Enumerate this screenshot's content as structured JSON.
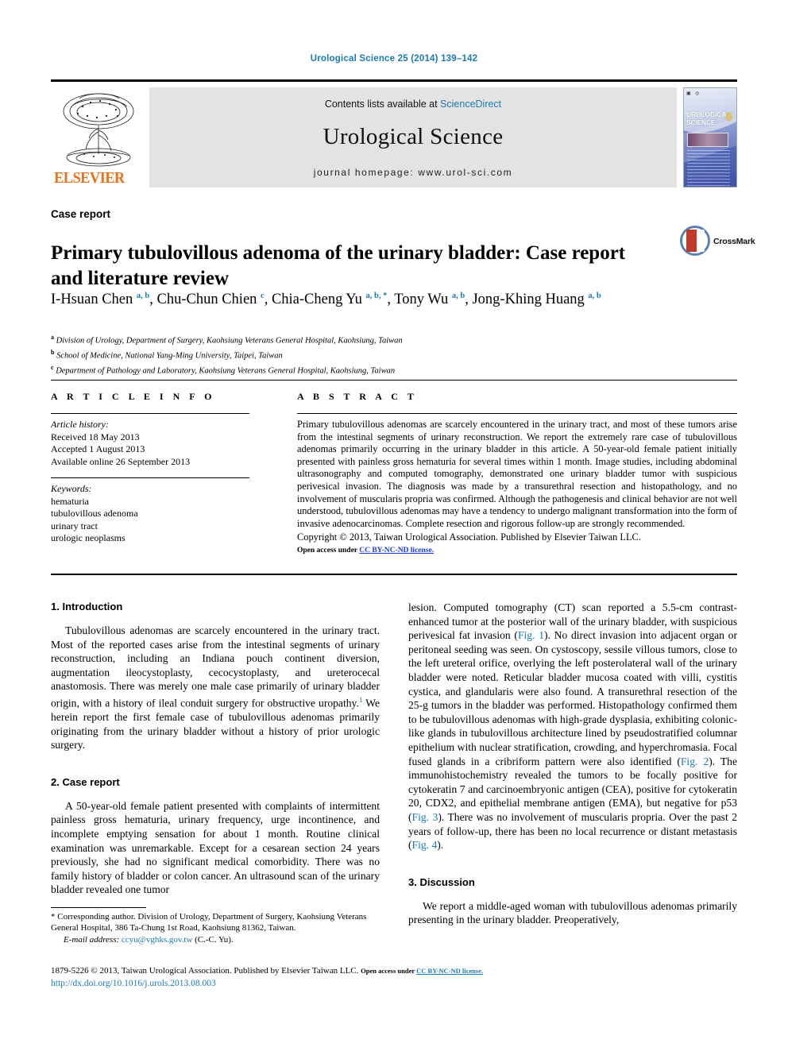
{
  "running_head": "Urological Science 25 (2014) 139–142",
  "masthead": {
    "contents_prefix": "Contents lists available at ",
    "sciencedirect": "ScienceDirect",
    "journal_name": "Urological Science",
    "homepage": "journal homepage: www.urol-sci.com",
    "publisher_logo_text": "ELSEVIER",
    "cover_title_line1": "UROLOGICAL",
    "cover_title_line2": "SCIENCE"
  },
  "article": {
    "type": "Case report",
    "title": "Primary tubulovillous adenoma of the urinary bladder: Case report and literature review",
    "crossmark_label": "CrossMark",
    "authors_html": "I-Hsuan Chen <sup>a, b</sup>, Chu-Chun Chien <sup>c</sup>, Chia-Cheng Yu <sup>a, b, *</sup>, Tony Wu <sup>a, b</sup>, Jong-Khing Huang <sup>a, b</sup>",
    "affiliations": [
      {
        "mark": "a",
        "text": "Division of Urology, Department of Surgery, Kaohsiung Veterans General Hospital, Kaohsiung, Taiwan"
      },
      {
        "mark": "b",
        "text": "School of Medicine, National Yang-Ming University, Taipei, Taiwan"
      },
      {
        "mark": "c",
        "text": "Department of Pathology and Laboratory, Kaohsiung Veterans General Hospital, Kaohsiung, Taiwan"
      }
    ]
  },
  "article_info": {
    "heading": "A R T I C L E   I N F O",
    "history_label": "Article history:",
    "history": [
      "Received 18 May 2013",
      "Accepted 1 August 2013",
      "Available online 26 September 2013"
    ],
    "keywords_label": "Keywords:",
    "keywords": [
      "hematuria",
      "tubulovillous adenoma",
      "urinary tract",
      "urologic neoplasms"
    ]
  },
  "abstract": {
    "heading": "A B S T R A C T",
    "text": "Primary tubulovillous adenomas are scarcely encountered in the urinary tract, and most of these tumors arise from the intestinal segments of urinary reconstruction. We report the extremely rare case of tubulovillous adenomas primarily occurring in the urinary bladder in this article. A 50-year-old female patient initially presented with painless gross hematuria for several times within 1 month. Image studies, including abdominal ultrasonography and computed tomography, demonstrated one urinary bladder tumor with suspicious perivesical invasion. The diagnosis was made by a transurethral resection and histopathology, and no involvement of muscularis propria was confirmed. Although the pathogenesis and clinical behavior are not well understood, tubulovillous adenomas may have a tendency to undergo malignant transformation into the form of invasive adenocarcinomas. Complete resection and rigorous follow-up are strongly recommended.",
    "copyright": "Copyright © 2013, Taiwan Urological Association. Published by Elsevier Taiwan LLC.",
    "open_access_prefix": "Open access under ",
    "open_access_link": "CC BY-NC-ND license."
  },
  "sections": {
    "intro_heading": "1.  Introduction",
    "intro_p1_a": "Tubulovillous adenomas are scarcely encountered in the urinary tract. Most of the reported cases arise from the intestinal segments of urinary reconstruction, including an Indiana pouch continent diversion, augmentation ileocystoplasty, cecocystoplasty, and ureterocecal anastomosis. There was merely one male case primarily of urinary bladder origin, with a history of ileal conduit surgery for obstructive uropathy.",
    "intro_ref": "1",
    "intro_p1_b": " We herein report the first female case of tubulovillous adenomas primarily originating from the urinary bladder without a history of prior urologic surgery.",
    "case_heading": "2.  Case report",
    "case_p1": "A 50-year-old female patient presented with complaints of intermittent painless gross hematuria, urinary frequency, urge incontinence, and incomplete emptying sensation for about 1 month. Routine clinical examination was unremarkable. Except for a cesarean section 24 years previously, she had no significant medical comorbidity. There was no family history of bladder or colon cancer. An ultrasound scan of the urinary bladder revealed one tumor",
    "case_cont_a": "lesion. Computed tomography (CT) scan reported a 5.5-cm contrast-enhanced tumor at the posterior wall of the urinary bladder, with suspicious perivesical fat invasion (",
    "fig1": "Fig. 1",
    "case_cont_b": "). No direct invasion into adjacent organ or peritoneal seeding was seen. On cystoscopy, sessile villous tumors, close to the left ureteral orifice, overlying the left posterolateral wall of the urinary bladder were noted. Reticular bladder mucosa coated with villi, cystitis cystica, and glandularis were also found. A transurethral resection of the 25-g tumors in the bladder was performed. Histopathology confirmed them to be tubulovillous adenomas with high-grade dysplasia, exhibiting colonic-like glands in tubulovillous architecture lined by pseudostratified columnar epithelium with nuclear stratification, crowding, and hyperchromasia. Focal fused glands in a cribriform pattern were also identified (",
    "fig2": "Fig. 2",
    "case_cont_c": "). The immunohistochemistry revealed the tumors to be focally positive for cytokeratin 7 and carcinoembryonic antigen (CEA), positive for cytokeratin 20, CDX2, and epithelial membrane antigen (EMA), but negative for p53 (",
    "fig3": "Fig. 3",
    "case_cont_d": "). There was no involvement of muscularis propria. Over the past 2 years of follow-up, there has been no local recurrence or distant metastasis (",
    "fig4": "Fig. 4",
    "case_cont_e": ").",
    "discussion_heading": "3.  Discussion",
    "discussion_p1": "We report a middle-aged woman with tubulovillous adenomas primarily presenting in the urinary bladder. Preoperatively,"
  },
  "footnote": {
    "star": "*",
    "corresponding": " Corresponding author. Division of Urology, Department of Surgery, Kaohsiung Veterans General Hospital, 386 Ta-Chung 1st Road, Kaohsiung 81362, Taiwan.",
    "email_label": "E-mail address:",
    "email": "ccyu@vghks.gov.tw",
    "email_suffix": " (C.-C. Yu)."
  },
  "imprint": {
    "line": "1879-5226 © 2013, Taiwan Urological Association. Published by Elsevier Taiwan LLC. ",
    "oa_prefix": "Open access under ",
    "oa_link": "CC BY-NC-ND license.",
    "doi": "http://dx.doi.org/10.1016/j.urols.2013.08.003"
  },
  "colors": {
    "accent_blue": "#1a7bb0",
    "link_blue": "#1a3fd0",
    "elsevier_orange": "#E9711C",
    "masthead_grey": "#e3e3e3"
  }
}
